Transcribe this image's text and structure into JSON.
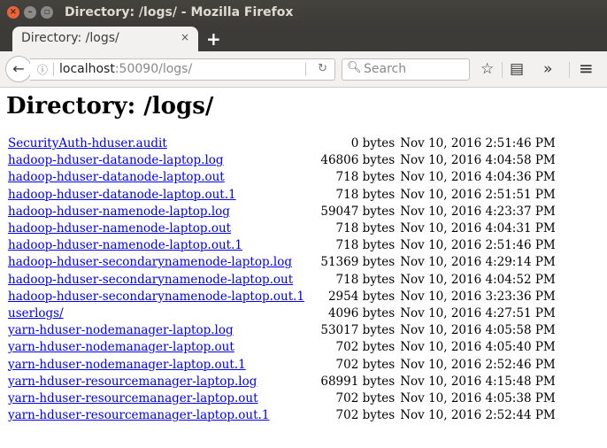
{
  "window": {
    "title": "Directory: /logs/ - Mozilla Firefox"
  },
  "tab": {
    "label": "Directory: /logs/"
  },
  "navbar": {
    "url_host": "localhost",
    "url_rest": ":50090/logs/",
    "search_placeholder": "Search"
  },
  "icons": {
    "close": "×",
    "new_tab": "+",
    "back": "←",
    "info": "ⓘ",
    "reload": "↻",
    "search": "⚲",
    "bookmark": "☆",
    "reader": "▤",
    "overflow": "»",
    "menu": "≡"
  },
  "page": {
    "heading": "Directory: /logs/",
    "files": [
      {
        "name": "SecurityAuth-hduser.audit",
        "size": "0 bytes",
        "date": "Nov 10, 2016 2:51:46 PM"
      },
      {
        "name": "hadoop-hduser-datanode-laptop.log",
        "size": "46806 bytes",
        "date": "Nov 10, 2016 4:04:58 PM"
      },
      {
        "name": "hadoop-hduser-datanode-laptop.out",
        "size": "718 bytes",
        "date": "Nov 10, 2016 4:04:36 PM"
      },
      {
        "name": "hadoop-hduser-datanode-laptop.out.1",
        "size": "718 bytes",
        "date": "Nov 10, 2016 2:51:51 PM"
      },
      {
        "name": "hadoop-hduser-namenode-laptop.log",
        "size": "59047 bytes",
        "date": "Nov 10, 2016 4:23:37 PM"
      },
      {
        "name": "hadoop-hduser-namenode-laptop.out",
        "size": "718 bytes",
        "date": "Nov 10, 2016 4:04:31 PM"
      },
      {
        "name": "hadoop-hduser-namenode-laptop.out.1",
        "size": "718 bytes",
        "date": "Nov 10, 2016 2:51:46 PM"
      },
      {
        "name": "hadoop-hduser-secondarynamenode-laptop.log",
        "size": "51369 bytes",
        "date": "Nov 10, 2016 4:29:14 PM"
      },
      {
        "name": "hadoop-hduser-secondarynamenode-laptop.out",
        "size": "718 bytes",
        "date": "Nov 10, 2016 4:04:52 PM"
      },
      {
        "name": "hadoop-hduser-secondarynamenode-laptop.out.1",
        "size": "2954 bytes",
        "date": "Nov 10, 2016 3:23:36 PM"
      },
      {
        "name": "userlogs/",
        "size": "4096 bytes",
        "date": "Nov 10, 2016 4:27:51 PM"
      },
      {
        "name": "yarn-hduser-nodemanager-laptop.log",
        "size": "53017 bytes",
        "date": "Nov 10, 2016 4:05:58 PM"
      },
      {
        "name": "yarn-hduser-nodemanager-laptop.out",
        "size": "702 bytes",
        "date": "Nov 10, 2016 4:05:40 PM"
      },
      {
        "name": "yarn-hduser-nodemanager-laptop.out.1",
        "size": "702 bytes",
        "date": "Nov 10, 2016 2:52:46 PM"
      },
      {
        "name": "yarn-hduser-resourcemanager-laptop.log",
        "size": "68991 bytes",
        "date": "Nov 10, 2016 4:15:48 PM"
      },
      {
        "name": "yarn-hduser-resourcemanager-laptop.out",
        "size": "702 bytes",
        "date": "Nov 10, 2016 4:05:38 PM"
      },
      {
        "name": "yarn-hduser-resourcemanager-laptop.out.1",
        "size": "702 bytes",
        "date": "Nov 10, 2016 2:52:44 PM"
      }
    ]
  }
}
